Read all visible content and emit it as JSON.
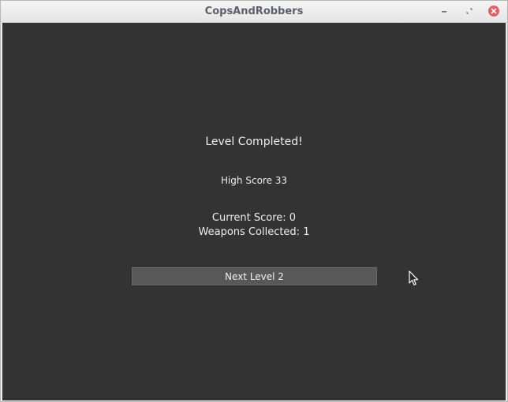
{
  "window": {
    "title": "CopsAndRobbers",
    "controls": {
      "minimize_icon": "minimize-icon",
      "maximize_icon": "restore-icon",
      "close_icon": "close-icon",
      "close_color": "#e95e66"
    }
  },
  "screen": {
    "heading": "Level Completed!",
    "high_score": "High Score 33",
    "current_score": "Current Score: 0",
    "weapons_collected": "Weapons Collected: 1",
    "next_button_label": "Next Level 2",
    "background_color": "#333333",
    "button_color": "#585858"
  },
  "pointer": {
    "icon": "mouse-cursor-icon"
  }
}
